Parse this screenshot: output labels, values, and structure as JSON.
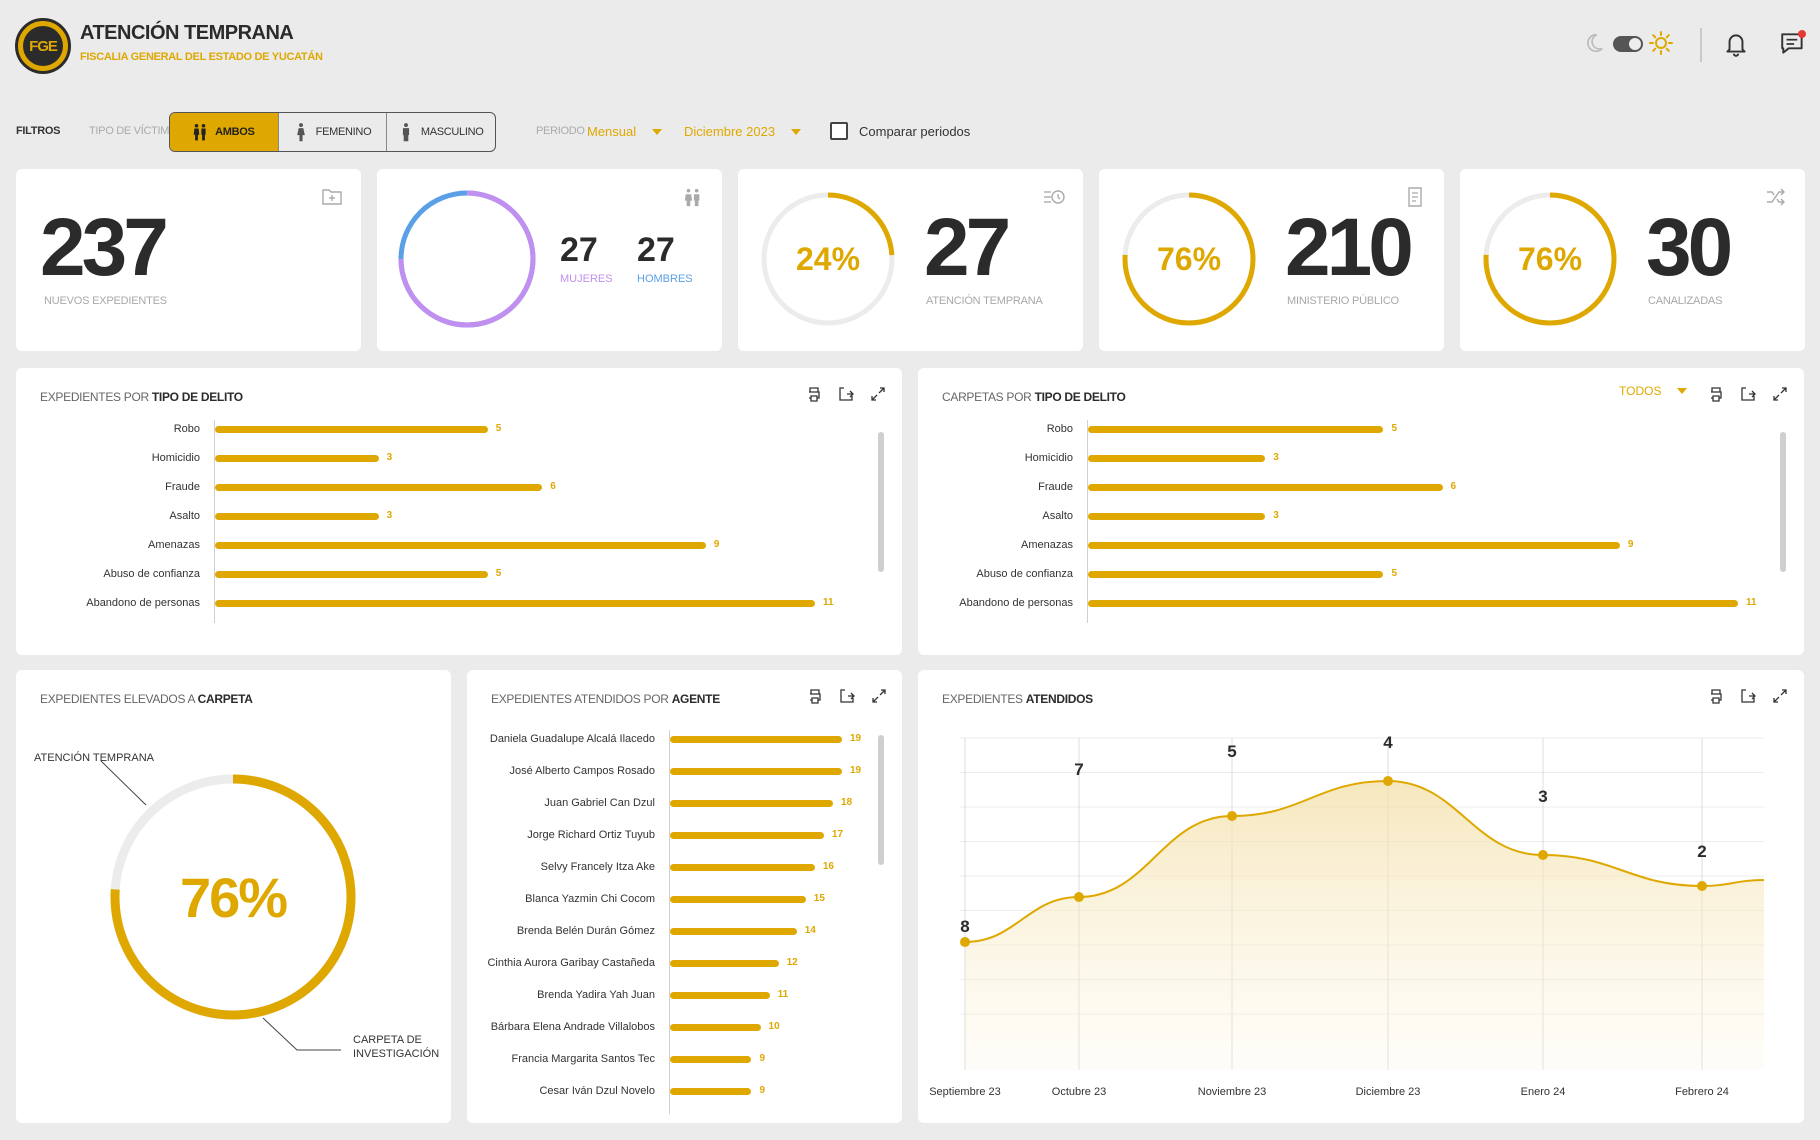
{
  "header": {
    "logo_text": "FGE",
    "title": "ATENCIÓN TEMPRANA",
    "subtitle": "FISCALIA GENERAL DEL ESTADO DE YUCATÁN"
  },
  "filters": {
    "label": "FILTROS",
    "victim_label": "TIPO DE VÍCTIMA",
    "victim_options": [
      {
        "label": "AMBOS",
        "icon": "couple-icon",
        "active": true
      },
      {
        "label": "FEMENINO",
        "icon": "woman-icon",
        "active": false
      },
      {
        "label": "MASCULINO",
        "icon": "man-icon",
        "active": false
      }
    ],
    "period_label": "PERIODO",
    "period_value": "Mensual",
    "month_value": "Diciembre 2023",
    "compare_label": "Comparar periodos"
  },
  "kpis": {
    "nuevos": {
      "value": "237",
      "label": "NUEVOS EXPEDIENTES"
    },
    "genero": {
      "mujeres_value": "27",
      "mujeres_label": "MUJERES",
      "hombres_value": "27",
      "hombres_label": "HOMBRES"
    },
    "atencion": {
      "percent": "24%",
      "percent_value": 24,
      "value": "27",
      "label": "ATENCIÓN TEMPRANA"
    },
    "ministerio": {
      "percent": "76%",
      "percent_value": 76,
      "value": "210",
      "label": "MINISTERIO PÚBLICO"
    },
    "canalizadas": {
      "percent": "76%",
      "percent_value": 76,
      "value": "30",
      "label": "CANALIZADAS"
    }
  },
  "panels": {
    "tipo_delito": {
      "title_a": "EXPEDIENTES POR ",
      "title_b": "TIPO DE DELITO"
    },
    "carpetas": {
      "title_a": "CARPETAS POR ",
      "title_b": "TIPO DE DELITO",
      "dropdown": "TODOS"
    },
    "elevados": {
      "title_a": "EXPEDIENTES ELEVADOS A ",
      "title_b": "CARPETA",
      "percent": "76%",
      "percent_value": 76,
      "label_top": "ATENCIÓN TEMPRANA",
      "label_bottom_1": "CARPETA DE",
      "label_bottom_2": "INVESTIGACIÓN"
    },
    "agente": {
      "title_a": "EXPEDIENTES ATENDIDOS POR ",
      "title_b": "AGENTE"
    },
    "atendidos": {
      "title_a": "EXPEDIENTES ",
      "title_b": "ATENDIDOS"
    }
  },
  "chart_data": [
    {
      "type": "bar",
      "title": "EXPEDIENTES POR TIPO DE DELITO",
      "categories": [
        "Robo",
        "Homicidio",
        "Fraude",
        "Asalto",
        "Amenazas",
        "Abuso de confianza",
        "Abandono de personas"
      ],
      "values": [
        5,
        3,
        6,
        3,
        9,
        5,
        11
      ],
      "xlim": [
        0,
        11
      ]
    },
    {
      "type": "bar",
      "title": "CARPETAS POR TIPO DE DELITO",
      "categories": [
        "Robo",
        "Homicidio",
        "Fraude",
        "Asalto",
        "Amenazas",
        "Abuso de confianza",
        "Abandono de personas"
      ],
      "values": [
        5,
        3,
        6,
        3,
        9,
        5,
        11
      ],
      "xlim": [
        0,
        11
      ]
    },
    {
      "type": "bar",
      "title": "EXPEDIENTES ATENDIDOS POR AGENTE",
      "categories": [
        "Daniela Guadalupe Alcalá Ilacedo",
        "José Alberto Campos Rosado",
        "Juan Gabriel Can Dzul",
        "Jorge Richard Ortiz Tuyub",
        "Selvy Francely Itza Ake",
        "Blanca Yazmin Chi Cocom",
        "Brenda Belén Durán Gómez",
        "Cinthia Aurora Garibay Castañeda",
        "Brenda Yadira Yah Juan",
        "Bárbara Elena Andrade Villalobos",
        "Francia Margarita Santos Tec",
        "Cesar Iván Dzul Novelo"
      ],
      "values": [
        19,
        19,
        18,
        17,
        16,
        15,
        14,
        12,
        11,
        10,
        9,
        9
      ],
      "xlim": [
        0,
        19
      ]
    },
    {
      "type": "area",
      "title": "EXPEDIENTES ATENDIDOS",
      "categories": [
        "Septiembre 23",
        "Octubre 23",
        "Noviembre 23",
        "Diciembre 23",
        "Enero 24",
        "Febrero 24"
      ],
      "labels": [
        "8",
        "7",
        "5",
        "4",
        "3",
        "2"
      ],
      "values": [
        8,
        7,
        5,
        4,
        3,
        2
      ],
      "grid": true
    }
  ],
  "colors": {
    "accent": "#dfa800",
    "female": "#c08ff0",
    "male": "#5aa0e6",
    "track": "#ececec"
  }
}
